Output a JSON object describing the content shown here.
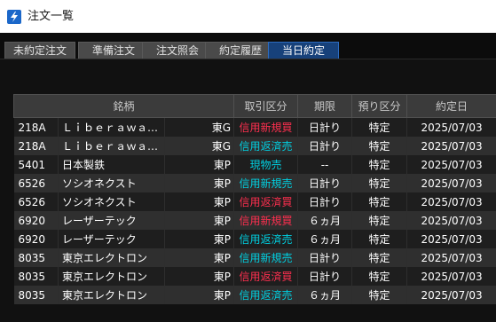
{
  "window": {
    "title": "注文一覧"
  },
  "tabs": [
    {
      "label": "未約定注文"
    },
    {
      "label": "準備注文"
    },
    {
      "label": "注文照会"
    },
    {
      "label": "約定履歴"
    },
    {
      "label": "当日約定",
      "active": true
    }
  ],
  "table": {
    "headers": [
      "銘柄",
      "取引区分",
      "期限",
      "預り区分",
      "約定日"
    ],
    "rows": [
      {
        "code": "218A",
        "name": "Ｌｉｂｅｒａｗａ…",
        "market": "東G",
        "trade": "信用新規買",
        "trade_color": "red",
        "term": "日計り",
        "account": "特定",
        "date": "2025/07/03"
      },
      {
        "code": "218A",
        "name": "Ｌｉｂｅｒａｗａ…",
        "market": "東G",
        "trade": "信用返済売",
        "trade_color": "cyan",
        "term": "日計り",
        "account": "特定",
        "date": "2025/07/03"
      },
      {
        "code": "5401",
        "name": "日本製鉄",
        "market": "東P",
        "trade": "現物売",
        "trade_color": "cyan",
        "term": "--",
        "account": "特定",
        "date": "2025/07/03"
      },
      {
        "code": "6526",
        "name": "ソシオネクスト",
        "market": "東P",
        "trade": "信用新規売",
        "trade_color": "cyan",
        "term": "日計り",
        "account": "特定",
        "date": "2025/07/03"
      },
      {
        "code": "6526",
        "name": "ソシオネクスト",
        "market": "東P",
        "trade": "信用返済買",
        "trade_color": "red",
        "term": "日計り",
        "account": "特定",
        "date": "2025/07/03"
      },
      {
        "code": "6920",
        "name": "レーザーテック",
        "market": "東P",
        "trade": "信用新規買",
        "trade_color": "red",
        "term": "６ヵ月",
        "account": "特定",
        "date": "2025/07/03"
      },
      {
        "code": "6920",
        "name": "レーザーテック",
        "market": "東P",
        "trade": "信用返済売",
        "trade_color": "cyan",
        "term": "６ヵ月",
        "account": "特定",
        "date": "2025/07/03"
      },
      {
        "code": "8035",
        "name": "東京エレクトロン",
        "market": "東P",
        "trade": "信用新規売",
        "trade_color": "cyan",
        "term": "日計り",
        "account": "特定",
        "date": "2025/07/03"
      },
      {
        "code": "8035",
        "name": "東京エレクトロン",
        "market": "東P",
        "trade": "信用返済買",
        "trade_color": "red",
        "term": "日計り",
        "account": "特定",
        "date": "2025/07/03"
      },
      {
        "code": "8035",
        "name": "東京エレクトロン",
        "market": "東P",
        "trade": "信用返済売",
        "trade_color": "cyan",
        "term": "６ヵ月",
        "account": "特定",
        "date": "2025/07/03"
      }
    ]
  },
  "colors": {
    "red": "#ff2f4f",
    "cyan": "#00cfe0",
    "active_tab": "#17417a"
  }
}
